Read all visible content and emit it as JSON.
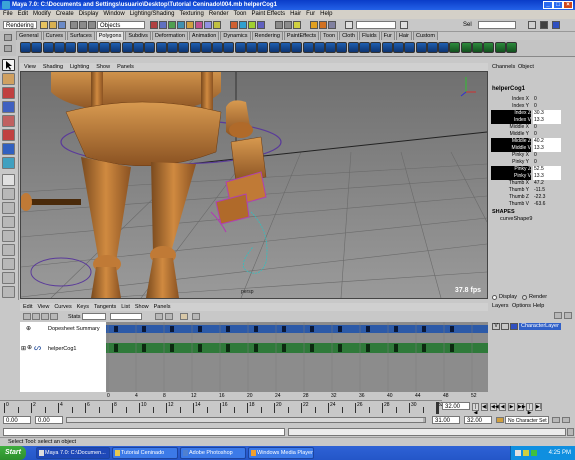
{
  "window": {
    "title": "Maya 7.0: C:\\Documents and Settings\\usuario\\Desktop\\Tutorial Ceninado\\004.mb   helperCog1"
  },
  "menu": [
    "File",
    "Edit",
    "Modify",
    "Create",
    "Display",
    "Window",
    "Lighting/Shading",
    "Texturing",
    "Render",
    "Toon",
    "Paint Effects",
    "Hair",
    "Fur",
    "Help"
  ],
  "status": {
    "mode": "Rendering",
    "objects_label": "Objects",
    "sel_label": "Sel"
  },
  "shelf_tabs": [
    "General",
    "Curves",
    "Surfaces",
    "Polygons",
    "Subdivs",
    "Deformation",
    "Animation",
    "Dynamics",
    "Rendering",
    "PaintEffects",
    "Toon",
    "Cloth",
    "Fluids",
    "Fur",
    "Hair",
    "Custom"
  ],
  "shelf_active": "Polygons",
  "viewport": {
    "menu": [
      "View",
      "Shading",
      "Lighting",
      "Show",
      "Panels"
    ],
    "fps": "37.8 fps",
    "camera": "persp"
  },
  "channel_box": {
    "tabs": [
      "Channels",
      "Object"
    ],
    "object": "helperCog1",
    "channels": [
      {
        "name": "Index X",
        "value": "0",
        "hl": false
      },
      {
        "name": "Index Y",
        "value": "0",
        "hl": false
      },
      {
        "name": "Index Z",
        "value": "30.3",
        "hl": true
      },
      {
        "name": "Index V",
        "value": "13.3",
        "hl": true
      },
      {
        "name": "Middle X",
        "value": "0",
        "hl": false
      },
      {
        "name": "Middle Y",
        "value": "0",
        "hl": false
      },
      {
        "name": "Middle Z",
        "value": "40.2",
        "hl": true
      },
      {
        "name": "Middle V",
        "value": "13.3",
        "hl": true
      },
      {
        "name": "Pinky X",
        "value": "0",
        "hl": false
      },
      {
        "name": "Pinky Y",
        "value": "0",
        "hl": false
      },
      {
        "name": "Pinky Z",
        "value": "52.5",
        "hl": true
      },
      {
        "name": "Pinky V",
        "value": "13.3",
        "hl": true
      },
      {
        "name": "Thumb X",
        "value": "47.2",
        "hl": false
      },
      {
        "name": "Thumb Y",
        "value": "-11.5",
        "hl": false
      },
      {
        "name": "Thumb Z",
        "value": "-22.3",
        "hl": false
      },
      {
        "name": "Thumb V",
        "value": "-63.6",
        "hl": false
      }
    ],
    "shapes_label": "SHAPES",
    "shape": "curveShape9"
  },
  "layers": {
    "display_label": "Display",
    "render_label": "Render",
    "menu": [
      "Layers",
      "Options",
      "Help"
    ],
    "layer_name": "CharacterLayer",
    "visible_flag": "V"
  },
  "dopesheet": {
    "menu": [
      "Edit",
      "View",
      "Curves",
      "Keys",
      "Tangents",
      "List",
      "Show",
      "Panels"
    ],
    "stats_label": "Stats",
    "rows": [
      "Dopesheet Summary",
      "helperCog1"
    ],
    "ruler": [
      "0",
      "4",
      "8",
      "12",
      "16",
      "20",
      "24",
      "28",
      "32",
      "36",
      "40",
      "44",
      "48",
      "52"
    ]
  },
  "timeline": {
    "ticks": [
      "0",
      "2",
      "4",
      "6",
      "8",
      "10",
      "12",
      "14",
      "16",
      "18",
      "20",
      "22",
      "24",
      "26",
      "28",
      "30",
      "32"
    ],
    "current": "32.00"
  },
  "range": {
    "start": "0.00",
    "inner_start": "0.00",
    "inner_end": "31.00",
    "end": "32.00",
    "character_set": "No Character Set"
  },
  "help_text": "Select Tool: select an object",
  "taskbar": {
    "start": "Start",
    "tasks": [
      "Maya 7.0: C:\\Documen...",
      "Tutorial Ceninado",
      "Adobe Photoshop",
      "Windows Media Player"
    ],
    "clock": "4:25 PM"
  }
}
